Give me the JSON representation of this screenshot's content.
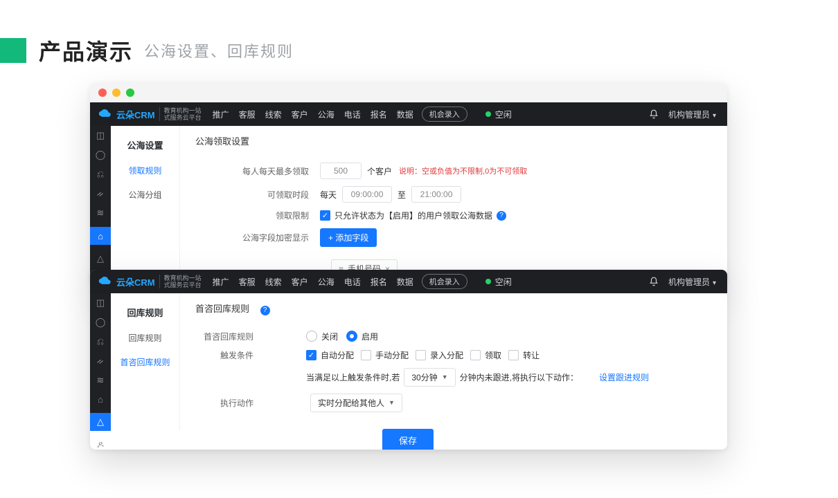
{
  "slide": {
    "title": "产品演示",
    "subtitle": "公海设置、回库规则"
  },
  "brand": {
    "name": "云朵CRM",
    "sub1": "教育机构一站",
    "sub2": "式服务云平台"
  },
  "nav": [
    "推广",
    "客服",
    "线索",
    "客户",
    "公海",
    "电话",
    "报名",
    "数据"
  ],
  "nav_pill": "机会录入",
  "status": "空闲",
  "user": "机构管理员",
  "win1": {
    "side_title": "公海设置",
    "side_items": [
      "领取规则",
      "公海分组"
    ],
    "side_active": 0,
    "content_title": "公海领取设置",
    "daily_label": "每人每天最多领取",
    "daily_value": "500",
    "daily_unit": "个客户",
    "daily_note_prefix": "说明：",
    "daily_note": "空或负值为不限制,0为不可领取",
    "time_label": "可领取时段",
    "time_every": "每天",
    "time_from": "09:00:00",
    "time_to_word": "至",
    "time_to": "21:00:00",
    "limit_label": "领取限制",
    "limit_text": "只允许状态为【启用】的用户领取公海数据",
    "mask_label": "公海字段加密显示",
    "mask_btn": "+ 添加字段",
    "mask_chip": "手机号码"
  },
  "win2": {
    "side_title": "回库规则",
    "side_items": [
      "回库规则",
      "首咨回库规则"
    ],
    "side_active": 1,
    "content_title": "首咨回库规则",
    "rule_label": "首咨回库规则",
    "radio_off": "关闭",
    "radio_on": "启用",
    "trig_label": "触发条件",
    "trig_opts": [
      "自动分配",
      "手动分配",
      "录入分配",
      "领取",
      "转让"
    ],
    "trig_checked": [
      true,
      false,
      false,
      false,
      false
    ],
    "cond_prefix": "当满足以上触发条件时,若",
    "cond_select": "30分钟",
    "cond_suffix": "分钟内未跟进,将执行以下动作：",
    "cond_link": "设置跟进规则",
    "act_label": "执行动作",
    "act_select": "实时分配给其他人",
    "save": "保存"
  }
}
